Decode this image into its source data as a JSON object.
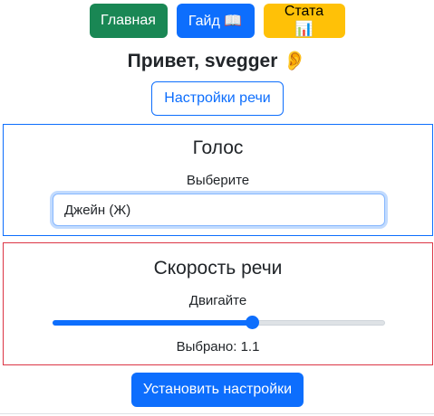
{
  "nav": {
    "home_label": "Главная",
    "guide_label": "Гайд 📖",
    "stats_label": "Стата 📊"
  },
  "greeting": "Привет, svegger 👂",
  "speech_settings_label": "Настройки речи",
  "voice": {
    "title": "Голос",
    "subtitle": "Выберите",
    "selected": "Джейн (Ж)"
  },
  "speed": {
    "title": "Скорость речи",
    "subtitle": "Двигайте",
    "selected_text": "Выбрано: 1.1",
    "slider_fraction": 0.6
  },
  "apply_label": "Установить настройки",
  "colors": {
    "home": "#198754",
    "primary": "#0d6efd",
    "stats": "#ffc107",
    "danger": "#dc3545"
  }
}
